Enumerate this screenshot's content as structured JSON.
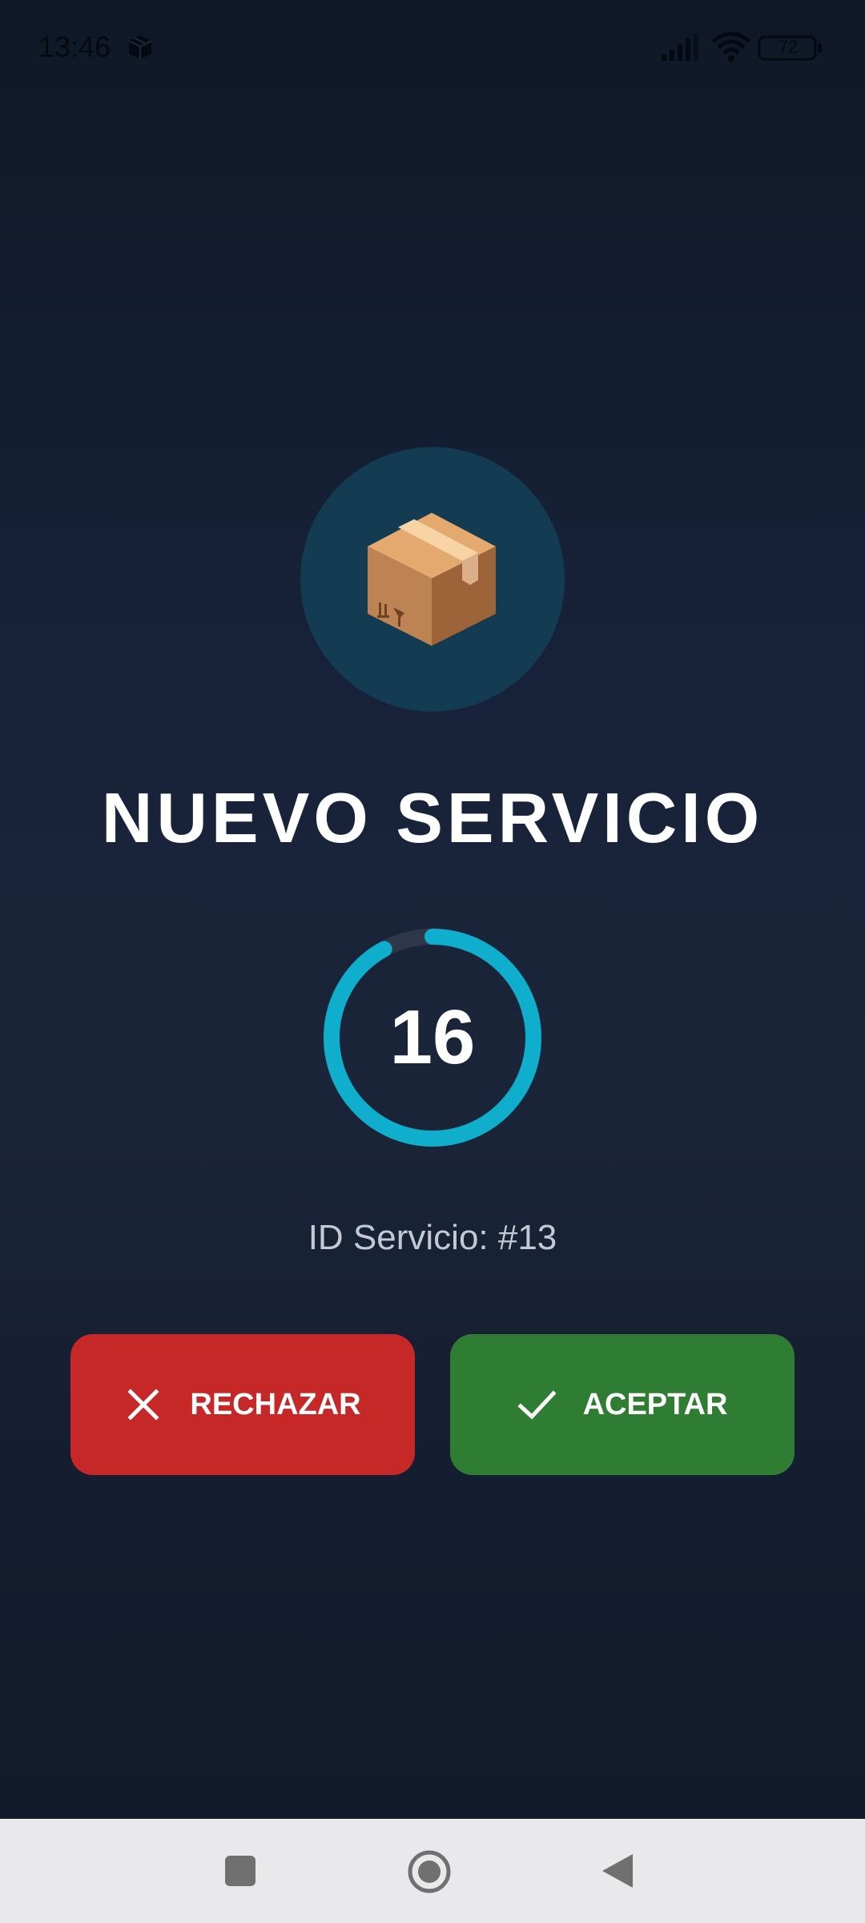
{
  "status_bar": {
    "time": "13:46",
    "battery": "72",
    "icons": [
      "box-app-icon",
      "signal-icon",
      "wifi-icon",
      "battery-icon"
    ]
  },
  "package_icon": "package-box-emoji",
  "title": "NUEVO SERVICIO",
  "countdown": {
    "value": "16",
    "progress_fraction": 0.92,
    "ring_color": "#0eaecc",
    "track_color": "#2d3748"
  },
  "service_id": "ID Servicio: #13",
  "buttons": {
    "reject_label": "RECHAZAR",
    "accept_label": "ACEPTAR",
    "reject_color": "#c62828",
    "accept_color": "#2e7d32"
  },
  "nav_bar": {
    "icons": [
      "recents-square-icon",
      "home-circle-icon",
      "back-triangle-icon"
    ]
  }
}
